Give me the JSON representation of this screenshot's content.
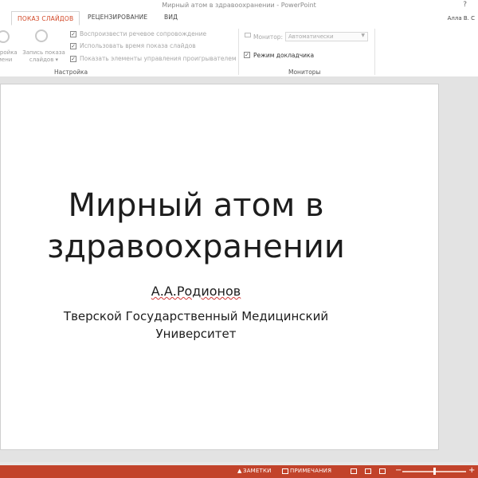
{
  "window": {
    "title": "Мирный атом в здравоохранении - PowerPoint",
    "help": "?",
    "minimize": "—",
    "user": "Алла В. С"
  },
  "tabs": [
    {
      "label": "ПОКАЗ СЛАЙДОВ",
      "active": true
    },
    {
      "label": "РЕЦЕНЗИРОВАНИЕ",
      "active": false
    },
    {
      "label": "ВИД",
      "active": false
    }
  ],
  "ribbon": {
    "setup_button_label": "стройка\nмени",
    "record_button_label": "Запись показа\nслайдов ▾",
    "options": [
      {
        "label": "Воспроизвести речевое сопровождение",
        "checked": true,
        "enabled": false
      },
      {
        "label": "Использовать время показа слайдов",
        "checked": true,
        "enabled": false
      },
      {
        "label": "Показать элементы управления проигрывателем",
        "checked": true,
        "enabled": false
      }
    ],
    "setup_group_label": "Настройка",
    "monitor_label": "Монитор:",
    "monitor_value": "Автоматически",
    "presenter_view_label": "Режим докладчика",
    "presenter_view_checked": true,
    "monitors_group_label": "Мониторы"
  },
  "slide": {
    "title_line1": "Мирный атом в",
    "title_line2": "здравоохранении",
    "author": "А.А.Родионов",
    "org_line1": "Тверской Государственный Медицинский",
    "org_line2": "Университет"
  },
  "statusbar": {
    "notes_label": "ЗАМЕТКИ",
    "comments_label": "ПРИМЕЧАНИЯ",
    "zoom_minus": "−",
    "zoom_plus": "+",
    "color": "#c2432b"
  }
}
